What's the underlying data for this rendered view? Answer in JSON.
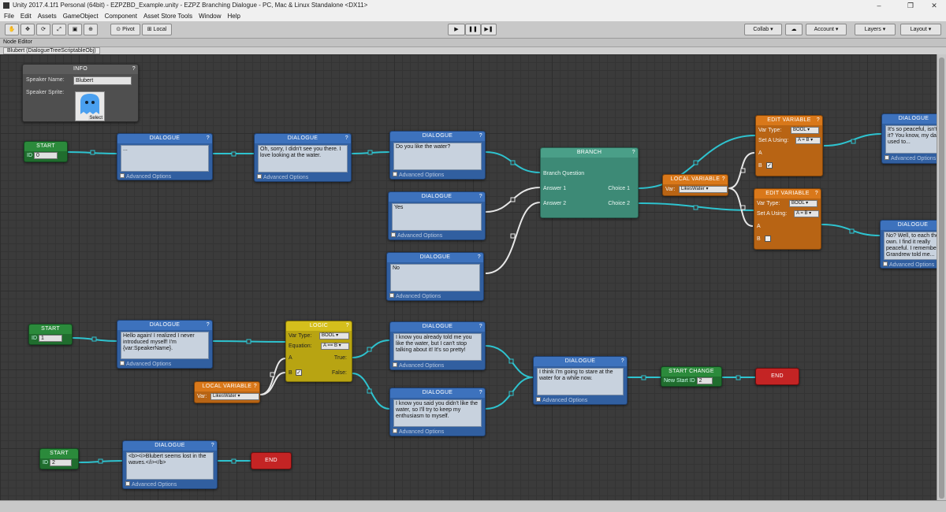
{
  "window": {
    "title": "Unity 2017.4.1f1 Personal (64bit) - EZPZBD_Example.unity - EZPZ Branching Dialogue - PC, Mac & Linux Standalone <DX11>",
    "minimize": "–",
    "maximize": "❐",
    "close": "✕"
  },
  "menu": [
    "File",
    "Edit",
    "Assets",
    "GameObject",
    "Component",
    "Asset Store Tools",
    "Window",
    "Help"
  ],
  "toolbar": {
    "pivot": "Pivot",
    "local": "Local",
    "play": "▶",
    "pause": "❚❚",
    "step": "▶❚",
    "collab": "Collab ▾",
    "cloud": "☁",
    "account": "Account",
    "layers": "Layers",
    "layout": "Layout"
  },
  "tab": "Node Editor",
  "object_label": "Blubert (DialogueTreeScriptableObj)",
  "info": {
    "title": "INFO",
    "speaker_name_label": "Speaker Name:",
    "speaker_name_value": "Blubert",
    "speaker_sprite_label": "Speaker Sprite:",
    "select_label": "Select"
  },
  "common": {
    "dialogue": "DIALOGUE",
    "start": "START",
    "end": "END",
    "id_label": "ID",
    "advanced_options": "Advanced Options",
    "help": "?",
    "branch": "BRANCH",
    "logic": "LOGIC",
    "local_variable": "LOCAL VARIABLE",
    "edit_variable": "EDIT VARIABLE",
    "start_change": "START CHANGE",
    "new_start_id": "New Start ID",
    "var_label": "Var:",
    "var_type": "Var Type:",
    "equation": "Equation:",
    "set_a_using": "Set A Using:",
    "a": "A",
    "b": "B",
    "true": "True:",
    "false": "False:",
    "branch_question": "Branch Question",
    "answer1": "Answer 1",
    "answer2": "Answer 2",
    "choice1": "Choice 1",
    "choice2": "Choice 2",
    "bool": "BOOL",
    "a_eq_b": "A == B",
    "a_set_b": "A = B",
    "likes_water": "LikesWater"
  },
  "starts": [
    {
      "id": "0"
    },
    {
      "id": "1"
    },
    {
      "id": "2"
    }
  ],
  "dialogues": [
    {
      "text": "..."
    },
    {
      "text": "Oh, sorry, I didn't see you there. I love looking at the water."
    },
    {
      "text": "Do you like the water?"
    },
    {
      "text": "Yes"
    },
    {
      "text": "No"
    },
    {
      "text": "It's so peaceful, isn't it? You know, my dad used to..."
    },
    {
      "text": "No? Well, to each their own. I find it really peaceful. I remember Grandrew told me..."
    },
    {
      "text": "Hello again! I realized I never introduced myself! I'm {var:SpeakerName}."
    },
    {
      "text": "I know you already told me you like the water, but I can't stop talking about it! It's so pretty!"
    },
    {
      "text": "I know you said you didn't like the water, so I'll try to keep my enthusiasm to myself."
    },
    {
      "text": "I think I'm going to stare at the water for a while now."
    },
    {
      "text": "<b><i>Blubert seems lost in the waves.</i></b>"
    }
  ],
  "start_change_id": "2"
}
